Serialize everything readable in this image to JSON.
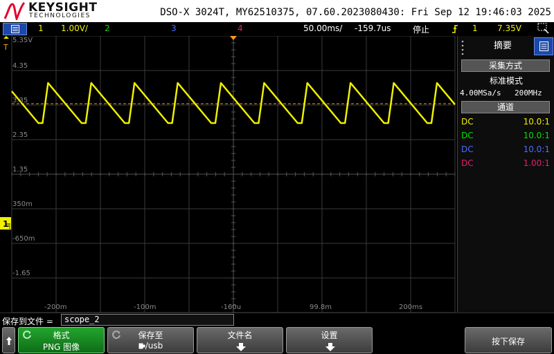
{
  "header": {
    "brand": "KEYSIGHT",
    "brand_sub": "TECHNOLOGIES",
    "instrument_info": "DSO-X 3024T, MY62510375, 07.60.2023080430: Fri Sep 12 19:46:03 2025"
  },
  "statusbar": {
    "ch1_num": "1",
    "ch1_scale": "1.00V/",
    "ch2_num": "2",
    "ch3_num": "3",
    "ch4_num": "4",
    "timebase": "50.00ms/",
    "delay": "-159.7us",
    "run_state": "停止",
    "trigger_source": "1",
    "trigger_level": "7.35V"
  },
  "graticule": {
    "y_labels": [
      "5.35V",
      "4.35",
      "3.35",
      "2.35",
      "1.35",
      "350m",
      "-650m",
      "-1.65"
    ],
    "x_labels": [
      "-200m",
      "-100m",
      "-160u",
      "99.8m",
      "200ms"
    ],
    "ground_marker": "1",
    "trigger_marker": "T"
  },
  "right_panel": {
    "tab_label": "摘要",
    "acq_button": "采集方式",
    "acq_mode": "标准模式",
    "sample_rate": "4.00MSa/s",
    "bandwidth": "200MHz",
    "channels_button": "通道",
    "channels": [
      {
        "coupling": "DC",
        "probe": "10.0:1",
        "color": "#f0f000"
      },
      {
        "coupling": "DC",
        "probe": "10.0:1",
        "color": "#00e000"
      },
      {
        "coupling": "DC",
        "probe": "10.0:1",
        "color": "#4a6cff"
      },
      {
        "coupling": "DC",
        "probe": "1.00:1",
        "color": "#e0206e"
      }
    ]
  },
  "save": {
    "label": "保存到文件 =",
    "filename": "scope_2"
  },
  "softkeys": {
    "format_line1": "格式",
    "format_line2": "PNG 图像",
    "save_to_line1": "保存至",
    "save_to_line2": "/usb",
    "filename_label": "文件名",
    "settings_label": "设置",
    "press_save_label": "按下保存"
  },
  "colors": {
    "ch1": "#f0f000",
    "ch2": "#00e000",
    "ch3": "#4a6cff",
    "ch4": "#e0206e",
    "trigger": "#ff9a1a",
    "accent": "#1c49a8"
  }
}
